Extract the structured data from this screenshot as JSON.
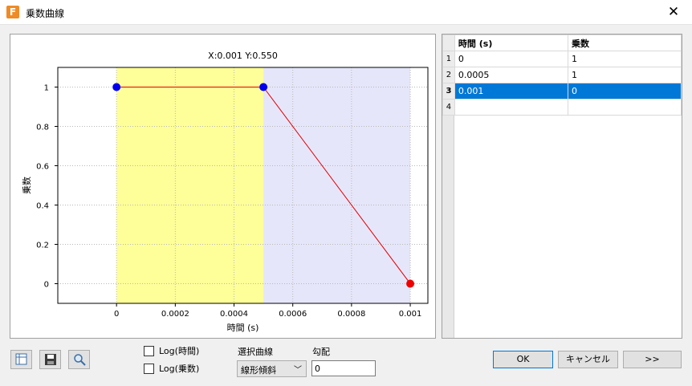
{
  "window": {
    "title": "乗数曲線",
    "app_icon_letter": "F"
  },
  "chart_data": {
    "type": "line",
    "title": "X:0.001 Y:0.550",
    "xlabel": "時間 (s)",
    "ylabel": "乗数",
    "xlim": [
      -0.0002,
      0.00106
    ],
    "ylim": [
      -0.1,
      1.1
    ],
    "x_ticks": [
      0,
      0.0002,
      0.0004,
      0.0006,
      0.0008,
      0.001
    ],
    "x_tick_labels": [
      "0",
      "0.0002",
      "0.0004",
      "0.0006",
      "0.0008",
      "0.001"
    ],
    "y_ticks": [
      0,
      0.2,
      0.4,
      0.6,
      0.8,
      1
    ],
    "y_tick_labels": [
      "0",
      "0.2",
      "0.4",
      "0.6",
      "0.8",
      "1"
    ],
    "grid": true,
    "regions": [
      {
        "x_start": 0,
        "x_end": 0.0005,
        "color": "#ffff99"
      },
      {
        "x_start": 0.0005,
        "x_end": 0.001,
        "color": "#e6e6fa"
      }
    ],
    "series": [
      {
        "x": [
          0,
          0.0005,
          0.001
        ],
        "values": [
          1,
          1,
          0
        ],
        "line_color": "#e00000",
        "point_colors": [
          "#0000ee",
          "#0000ee",
          "#ee0000"
        ]
      }
    ]
  },
  "table": {
    "columns": [
      "時間 (s)",
      "乗数"
    ],
    "rows": [
      {
        "num": "1",
        "cells": [
          "0",
          "1"
        ]
      },
      {
        "num": "2",
        "cells": [
          "0.0005",
          "1"
        ]
      },
      {
        "num": "3",
        "cells": [
          "0.001",
          "0"
        ]
      },
      {
        "num": "4",
        "cells": [
          "",
          ""
        ]
      }
    ],
    "selected_row": "3"
  },
  "options": {
    "log_time_label": "Log(時間)",
    "log_mult_label": "Log(乗数)",
    "curve_label": "選択曲線",
    "curve_value": "線形傾斜",
    "slope_label": "勾配",
    "slope_value": "0"
  },
  "buttons": {
    "ok": "OK",
    "cancel": "キャンセル",
    "more": ">>"
  },
  "toolbar": {
    "icons": [
      "table-icon",
      "save-icon",
      "zoom-icon"
    ]
  }
}
